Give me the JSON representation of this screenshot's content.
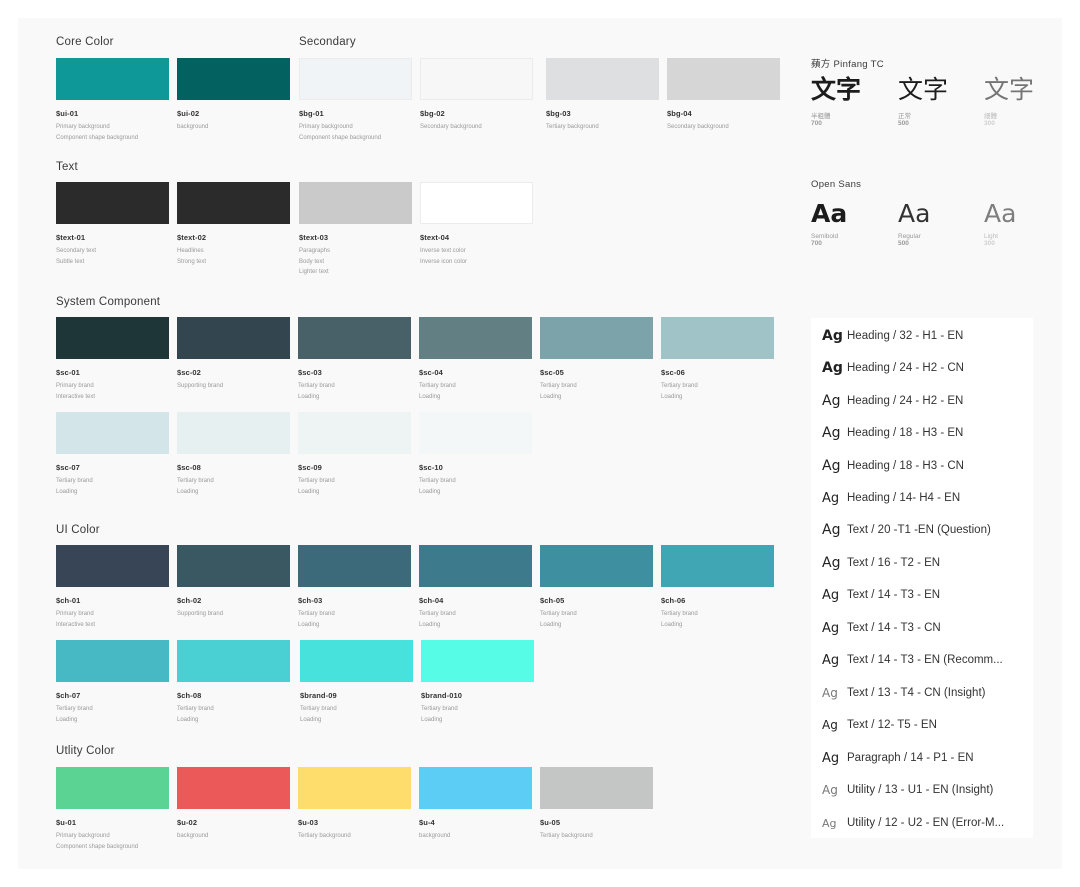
{
  "sections": {
    "core": {
      "title": "Core Color",
      "swatches": [
        {
          "code": "$ui-01",
          "color": "#0e9898",
          "desc": [
            "Primary background",
            "Component shape background"
          ]
        },
        {
          "code": "$ui-02",
          "color": "#03625f",
          "desc": [
            "background"
          ]
        }
      ]
    },
    "secondary": {
      "title": "Secondary",
      "swatches": [
        {
          "code": "$bg-01",
          "color": "#f1f4f6",
          "desc": [
            "Primary background",
            "Component shape background"
          ]
        },
        {
          "code": "$bg-02",
          "color": "#f7f7f7",
          "desc": [
            "Secondary background"
          ]
        },
        {
          "code": "$bg-03",
          "color": "#dedfe0",
          "desc": [
            "Tertiary background"
          ]
        },
        {
          "code": "$bg-04",
          "color": "#d6d6d7",
          "desc": [
            "Secondary background"
          ]
        }
      ]
    },
    "text": {
      "title": "Text",
      "swatches": [
        {
          "code": "$text-01",
          "color": "#2b2b2b",
          "desc": [
            "Secondary text",
            "Subtle text"
          ]
        },
        {
          "code": "$text-02",
          "color": "#2b2b2b",
          "desc": [
            "Headlines",
            "Strong text"
          ]
        },
        {
          "code": "$text-03",
          "color": "#cacacb",
          "desc": [
            "Paragraphs",
            "Body text",
            "Lighter text"
          ]
        },
        {
          "code": "$text-04",
          "color": "#ffffff",
          "desc": [
            "Inverse text color",
            "Inverse icon color"
          ]
        }
      ]
    },
    "system": {
      "title": "System Component",
      "swatches": [
        {
          "code": "$sc-01",
          "color": "#1f3639",
          "desc": [
            "Primary brand",
            "Interactive text"
          ]
        },
        {
          "code": "$sc-02",
          "color": "#33464f",
          "desc": [
            "Supporting brand"
          ]
        },
        {
          "code": "$sc-03",
          "color": "#486169",
          "desc": [
            "Tertiary brand",
            "Loading"
          ]
        },
        {
          "code": "$sc-04",
          "color": "#628083",
          "desc": [
            "Tertiary brand",
            "Loading"
          ]
        },
        {
          "code": "$sc-05",
          "color": "#7ba3a9",
          "desc": [
            "Tertiary brand",
            "Loading"
          ]
        },
        {
          "code": "$sc-06",
          "color": "#9fc3c7",
          "desc": [
            "Tertiary brand",
            "Loading"
          ]
        },
        {
          "code": "$sc-07",
          "color": "#d3e5e8",
          "desc": [
            "Tertiary brand",
            "Loading"
          ]
        },
        {
          "code": "$sc-08",
          "color": "#e6f0f0",
          "desc": [
            "Tertiary brand",
            "Loading"
          ]
        },
        {
          "code": "$sc-09",
          "color": "#eef4f4",
          "desc": [
            "Tertiary brand",
            "Loading"
          ]
        },
        {
          "code": "$sc-10",
          "color": "#f4f7f7",
          "desc": [
            "Tertiary brand",
            "Loading"
          ]
        }
      ]
    },
    "ui": {
      "title": "UI Color",
      "swatches": [
        {
          "code": "$ch-01",
          "color": "#374556",
          "desc": [
            "Primary brand",
            "Interactive text"
          ]
        },
        {
          "code": "$ch-02",
          "color": "#3a5862",
          "desc": [
            "Supporting brand"
          ]
        },
        {
          "code": "$ch-03",
          "color": "#3d6a7b",
          "desc": [
            "Tertiary brand",
            "Loading"
          ]
        },
        {
          "code": "$ch-04",
          "color": "#3d7a8c",
          "desc": [
            "Tertiary brand",
            "Loading"
          ]
        },
        {
          "code": "$ch-05",
          "color": "#3e8f9f",
          "desc": [
            "Tertiary brand",
            "Loading"
          ]
        },
        {
          "code": "$ch-06",
          "color": "#41a6b3",
          "desc": [
            "Tertiary brand",
            "Loading"
          ]
        },
        {
          "code": "$ch-07",
          "color": "#47b9c4",
          "desc": [
            "Tertiary brand",
            "Loading"
          ]
        },
        {
          "code": "$ch-08",
          "color": "#4acfd2",
          "desc": [
            "Tertiary brand",
            "Loading"
          ]
        },
        {
          "code": "$brand-09",
          "color": "#48e2dd",
          "desc": [
            "Tertiary brand",
            "Loading"
          ]
        },
        {
          "code": "$brand-010",
          "color": "#56fce6",
          "desc": [
            "Tertiary brand",
            "Loading"
          ]
        }
      ]
    },
    "utility": {
      "title": "Utlity Color",
      "swatches": [
        {
          "code": "$u-01",
          "color": "#5bd493",
          "desc": [
            "Primary background",
            "Component shape background"
          ]
        },
        {
          "code": "$u-02",
          "color": "#eb5a59",
          "desc": [
            "background"
          ]
        },
        {
          "code": "$u-03",
          "color": "#fedd6c",
          "desc": [
            "Tertiary background"
          ]
        },
        {
          "code": "$u-4",
          "color": "#5ccef6",
          "desc": [
            "background"
          ]
        },
        {
          "code": "$u-05",
          "color": "#c4c5c5",
          "desc": [
            "Tertiary background"
          ]
        }
      ]
    }
  },
  "fonts": {
    "pingfang": {
      "title": "蘋方  Pinfang TC",
      "samples": [
        {
          "glyph": "文字",
          "name": "半粗體",
          "weight": "700",
          "color": "#1c1c1c"
        },
        {
          "glyph": "文字",
          "name": "正常",
          "weight": "500",
          "color": "#1c1c1c"
        },
        {
          "glyph": "文字",
          "name": "細體",
          "weight": "300",
          "color": "#555555"
        }
      ]
    },
    "opensans": {
      "title": "Open Sans",
      "samples": [
        {
          "glyph": "Aa",
          "name": "Semibold",
          "weight": "700",
          "color": "#1c1c1c"
        },
        {
          "glyph": "Aa",
          "name": "Regular",
          "weight": "500",
          "color": "#333333"
        },
        {
          "glyph": "Aa",
          "name": "Light",
          "weight": "300",
          "color": "#555555"
        }
      ]
    }
  },
  "type_styles": {
    "ag": "Ag",
    "items": [
      "Heading / 32 - H1 - EN",
      "Heading / 24 - H2 - CN",
      "Heading / 24 - H2 - EN",
      "Heading / 18 - H3 - EN",
      "Heading / 18 - H3 - CN",
      "Heading / 14- H4 - EN",
      "Text / 20 -T1 -EN (Question)",
      "Text / 16 - T2 - EN",
      "Text / 14 - T3 - EN",
      "Text / 14 - T3 - CN",
      "Text / 14 - T3 - EN (Recomm...",
      "Text / 13 - T4 - CN (Insight)",
      "Text / 12- T5 - EN",
      "Paragraph / 14 - P1 - EN",
      "Utility / 13 - U1 - EN (Insight)",
      "Utility / 12 - U2 - EN (Error-M..."
    ]
  }
}
